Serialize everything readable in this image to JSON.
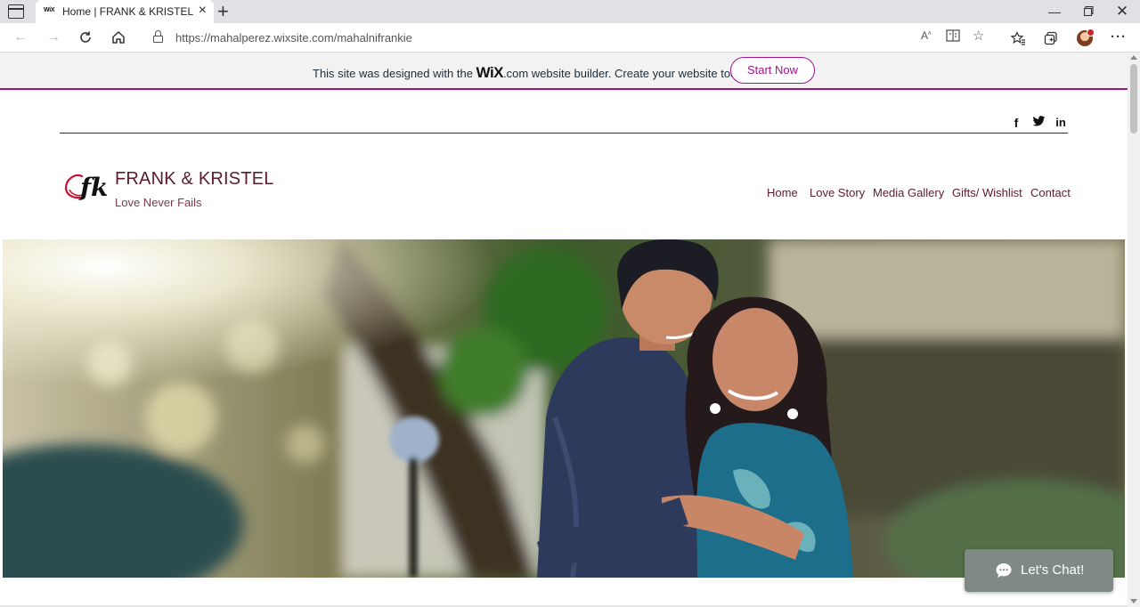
{
  "browser": {
    "tab_favicon": "WiX",
    "tab_title": "Home | FRANK & KRISTEL",
    "url_host": "https://mahalperez.wixsite.com",
    "url_path": "/mahalnifrankie",
    "icons": [
      "tab-actions-icon",
      "back-icon",
      "forward-icon",
      "refresh-icon",
      "home-icon",
      "lock-icon",
      "read-aloud-icon",
      "immersive-reader-icon",
      "add-favorite-icon",
      "favorites-icon",
      "collections-icon",
      "profile-icon",
      "more-icon",
      "minimize-icon",
      "maximize-icon",
      "close-icon"
    ]
  },
  "wix_banner": {
    "text_before": "This site was designed with the ",
    "logo": "WiX",
    "text_after": ".com website builder. Create your website today.",
    "button": "Start Now",
    "accent_color": "#a0138e"
  },
  "site": {
    "title": "FRANK & KRISTEL",
    "tagline": "Love Never Fails",
    "logo_mark": "fk",
    "social": [
      "f",
      "t",
      "in"
    ],
    "nav": [
      "Home",
      "Love Story",
      "Media Gallery",
      "Gifts/ Wishlist",
      "Contact"
    ],
    "brand_color": "#5a1c2b"
  },
  "chat": {
    "label": "Let's Chat!"
  }
}
